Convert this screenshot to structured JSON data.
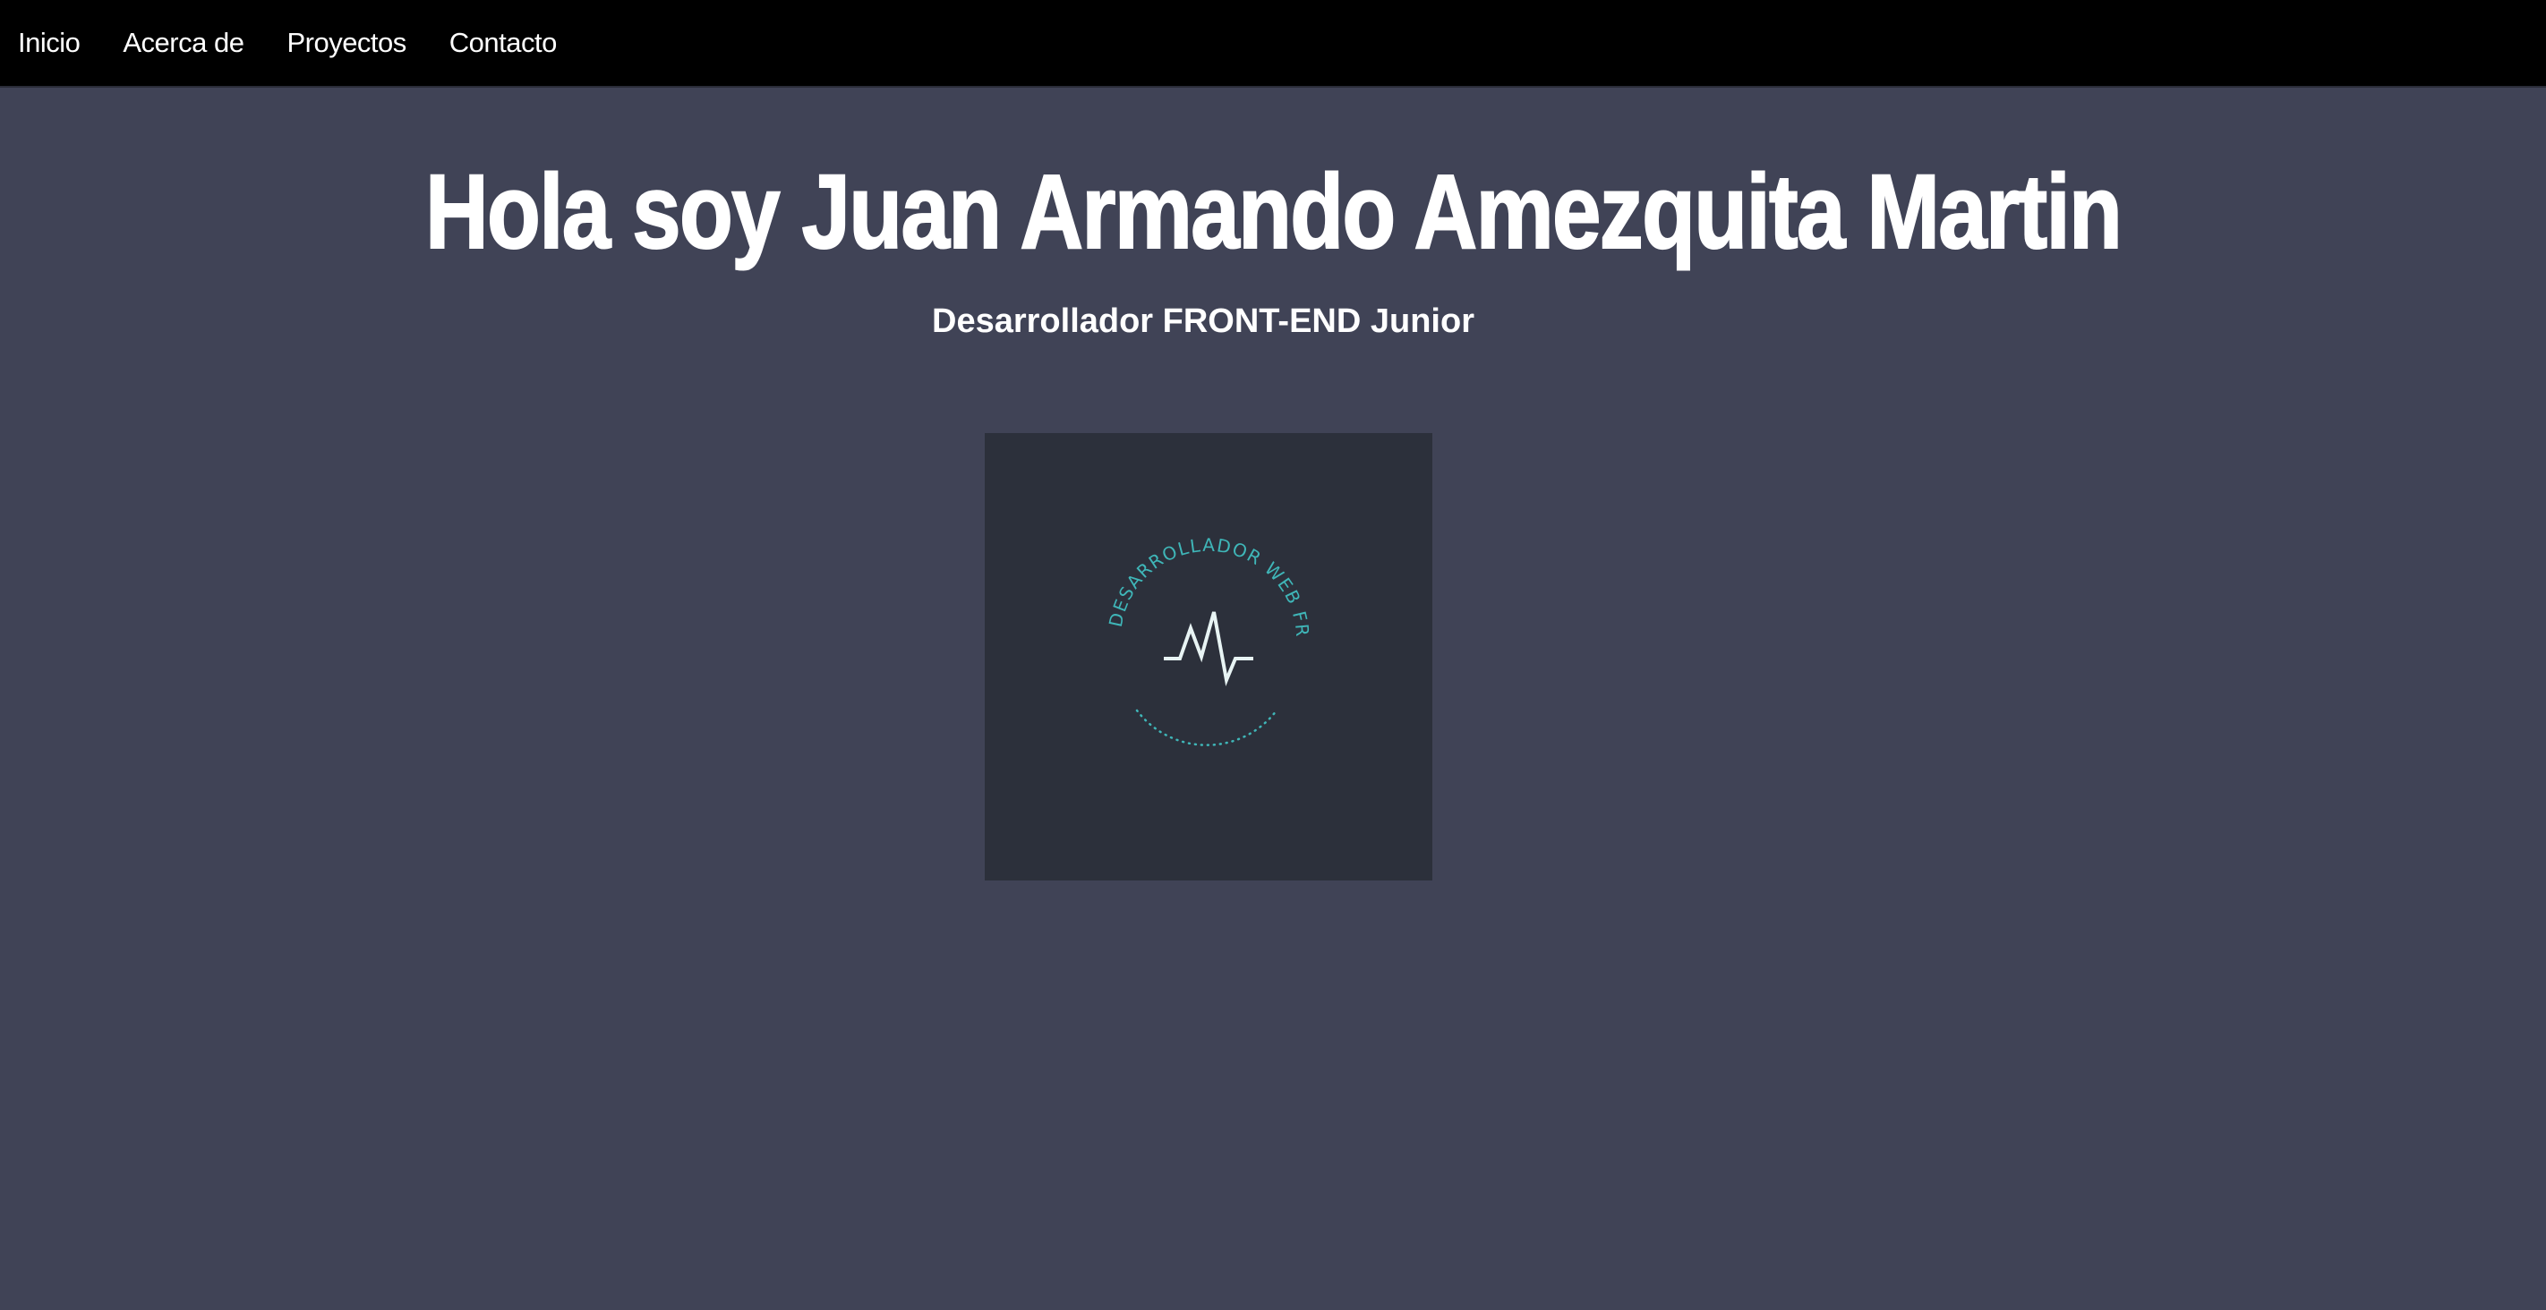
{
  "nav": {
    "items": [
      {
        "label": "Inicio"
      },
      {
        "label": "Acerca de"
      },
      {
        "label": "Proyectos"
      },
      {
        "label": "Contacto"
      }
    ]
  },
  "hero": {
    "title": "Hola soy Juan Armando Amezquita Martin",
    "subtitle": "Desarrollador FRONT-END Junior"
  },
  "logo": {
    "ring_text": "DESARROLLADOR WEB FRONT-END",
    "icon": "heartbeat-pulse-icon",
    "accent_color": "#3fb6b8",
    "line_color": "#e8f4f4"
  },
  "colors": {
    "navbar_bg": "#000000",
    "page_bg": "#404356",
    "card_bg": "#2c303b"
  }
}
